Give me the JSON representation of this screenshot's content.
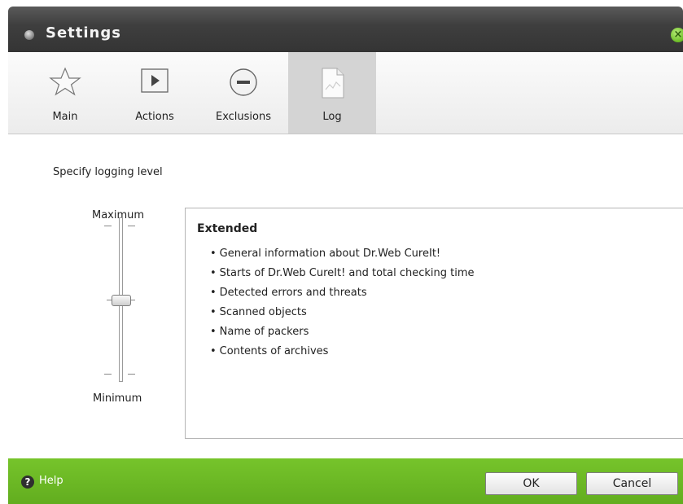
{
  "window": {
    "title": "Settings"
  },
  "tabs": [
    {
      "label": "Main",
      "icon": "star-icon"
    },
    {
      "label": "Actions",
      "icon": "play-icon"
    },
    {
      "label": "Exclusions",
      "icon": "minus-circle-icon"
    },
    {
      "label": "Log",
      "icon": "log-document-icon",
      "active": true
    }
  ],
  "log": {
    "prompt": "Specify logging level",
    "slider": {
      "max_label": "Maximum",
      "min_label": "Minimum",
      "level_fraction": 0.5
    },
    "level": {
      "name": "Extended",
      "items": [
        "General information about Dr.Web CureIt!",
        "Starts of Dr.Web CureIt! and total checking time",
        "Detected errors and threats",
        "Scanned objects",
        "Name of packers",
        "Contents of archives"
      ]
    }
  },
  "footer": {
    "help_label": "Help",
    "ok_label": "OK",
    "cancel_label": "Cancel"
  },
  "colors": {
    "accent": "#6cb726",
    "titlebar": "#3f3f3f"
  }
}
